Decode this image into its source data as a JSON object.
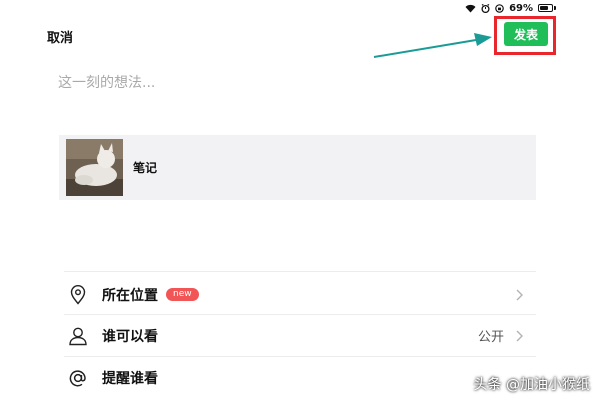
{
  "status_bar": {
    "battery_percent": "69%",
    "battery_level": 0.69,
    "icons": [
      "wifi-icon",
      "alarm-icon",
      "orientation-lock-icon",
      "battery-icon"
    ]
  },
  "header": {
    "cancel_label": "取消",
    "publish_label": "发表"
  },
  "composer": {
    "placeholder": "这一刻的想法...",
    "value": ""
  },
  "attachment": {
    "title": "笔记"
  },
  "options": {
    "location": {
      "label": "所在位置",
      "badge": "new",
      "icon": "location-pin-icon"
    },
    "visibility": {
      "label": "谁可以看",
      "value": "公开",
      "icon": "person-icon"
    },
    "mention": {
      "label": "提醒谁看",
      "icon": "at-sign-icon"
    }
  },
  "watermark": "头条 @加油小猴纸",
  "colors": {
    "publish_green": "#1fbe58",
    "highlight_red": "#e8262b",
    "arrow_teal": "#1a9b95",
    "badge_red": "#f25555"
  }
}
